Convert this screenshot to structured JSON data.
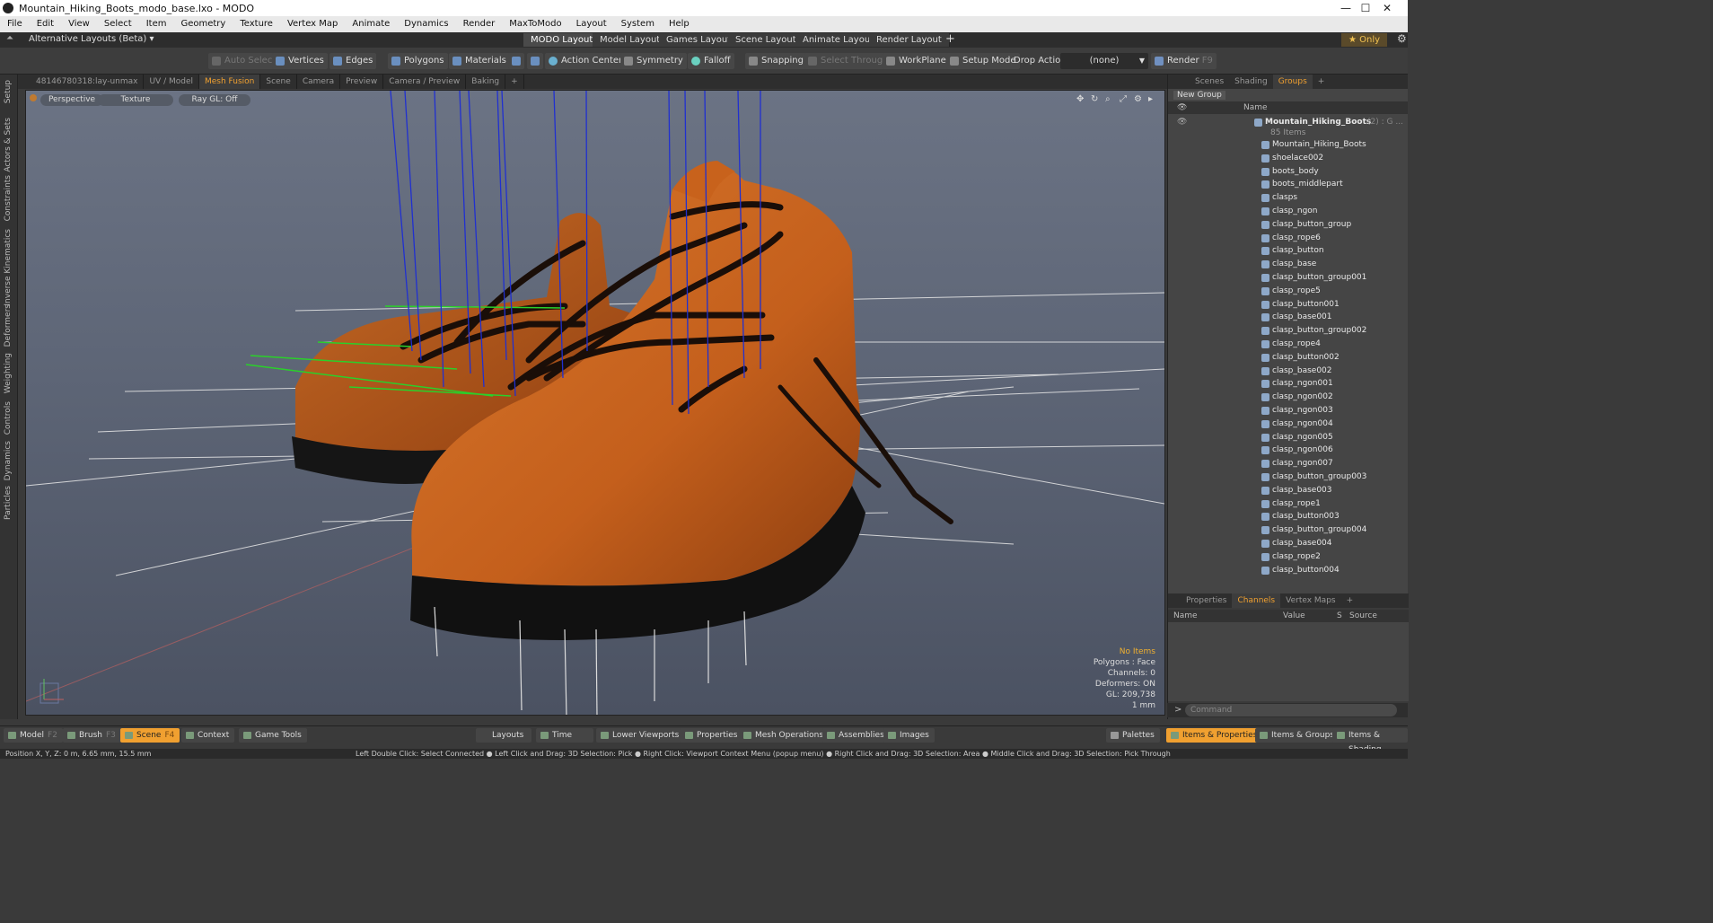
{
  "window": {
    "title": "Mountain_Hiking_Boots_modo_base.lxo - MODO",
    "controls": [
      "—",
      "☐",
      "✕"
    ]
  },
  "menu": [
    "File",
    "Edit",
    "View",
    "Select",
    "Item",
    "Geometry",
    "Texture",
    "Vertex Map",
    "Animate",
    "Dynamics",
    "Render",
    "MaxToModo",
    "Layout",
    "System",
    "Help"
  ],
  "layoutbar": {
    "alt_layout": "Alternative Layouts (Beta) ▾",
    "tabs": [
      "MODO Layout",
      "Model Layout",
      "Games Layout",
      "Scene Layout",
      "Animate Layout",
      "Render Layout"
    ],
    "active_tab": "MODO Layout",
    "add": "+",
    "only": "★ Only"
  },
  "toolbar": {
    "auto_select": "Auto Select",
    "vertices": "Vertices",
    "edges": "Edges",
    "polygons": "Polygons",
    "materials": "Materials",
    "action_center": "Action Center",
    "symmetry": "Symmetry",
    "falloff": "Falloff",
    "snapping": "Snapping",
    "select_through": "Select Through",
    "workplane": "WorkPlane",
    "setup_mode": "Setup Mode",
    "drop_action": "Drop Action",
    "drop_value": "(none)",
    "render": "Render",
    "render_key": "F9"
  },
  "left_tabs": [
    "Setup",
    "Actors & Sets",
    "Constraints",
    "Inverse Kinematics",
    "Deformers",
    "Weighting",
    "Controls",
    "Dynamics",
    "Particles"
  ],
  "viewport_tabs": [
    "48146780318:lay-unmax",
    "UV / Model",
    "Mesh Fusion",
    "Scene",
    "Camera",
    "Preview",
    "Camera / Preview",
    "Baking",
    "+"
  ],
  "viewport_active_tab": "Mesh Fusion",
  "viewport": {
    "view": "Perspective",
    "shading": "Texture",
    "raygl": "Ray GL: Off",
    "info": {
      "no_items": "No Items",
      "polygons": "Polygons : Face",
      "channels": "Channels: 0",
      "deformers": "Deformers: ON",
      "gl": "GL: 209,738",
      "scale": "1 mm"
    }
  },
  "right_panel": {
    "tabs": [
      "Scenes",
      "Shading",
      "Groups",
      "+"
    ],
    "active_tab": "Groups",
    "new_group": "New Group",
    "name_col": "Name",
    "root": "Mountain_Hiking_Boots",
    "root_suffix": "(2) : G ...",
    "root_count": "85 Items",
    "items": [
      "Mountain_Hiking_Boots",
      "shoelace002",
      "boots_body",
      "boots_middlepart",
      "clasps",
      "clasp_ngon",
      "clasp_button_group",
      "clasp_rope6",
      "clasp_button",
      "clasp_base",
      "clasp_button_group001",
      "clasp_rope5",
      "clasp_button001",
      "clasp_base001",
      "clasp_button_group002",
      "clasp_rope4",
      "clasp_button002",
      "clasp_base002",
      "clasp_ngon001",
      "clasp_ngon002",
      "clasp_ngon003",
      "clasp_ngon004",
      "clasp_ngon005",
      "clasp_ngon006",
      "clasp_ngon007",
      "clasp_button_group003",
      "clasp_base003",
      "clasp_rope1",
      "clasp_button003",
      "clasp_button_group004",
      "clasp_base004",
      "clasp_rope2",
      "clasp_button004"
    ]
  },
  "channels_panel": {
    "tabs": [
      "Properties",
      "Channels",
      "Vertex Maps",
      "+"
    ],
    "active_tab": "Channels",
    "columns": [
      "Name",
      "Value",
      "S",
      "Source"
    ]
  },
  "command": {
    "prompt": ">",
    "placeholder": "Command"
  },
  "bottom": {
    "model": "Model",
    "model_key": "F2",
    "brush": "Brush",
    "brush_key": "F3",
    "scene": "Scene",
    "scene_key": "F4",
    "context": "Context",
    "game_tools": "Game Tools",
    "layouts": "Layouts",
    "time": "Time",
    "lower_viewports": "Lower Viewports",
    "properties": "Properties",
    "mesh_ops": "Mesh Operations",
    "assemblies": "Assemblies",
    "images": "Images",
    "palettes": "Palettes",
    "items_props": "Items & Properties",
    "items_groups": "Items & Groups",
    "items_shading": "Items & Shading"
  },
  "status": {
    "position": "Position X, Y, Z:   0 m, 6.65 mm, 15.5 mm",
    "hints": "Left Double Click: Select Connected ● Left Click and Drag: 3D Selection: Pick ● Right Click: Viewport Context Menu (popup menu) ● Right Click and Drag: 3D Selection: Area ● Middle Click and Drag: 3D Selection: Pick Through"
  },
  "colors": {
    "accent": "#f0a030",
    "boot_leather": "#c8621c",
    "sole": "#111111"
  }
}
